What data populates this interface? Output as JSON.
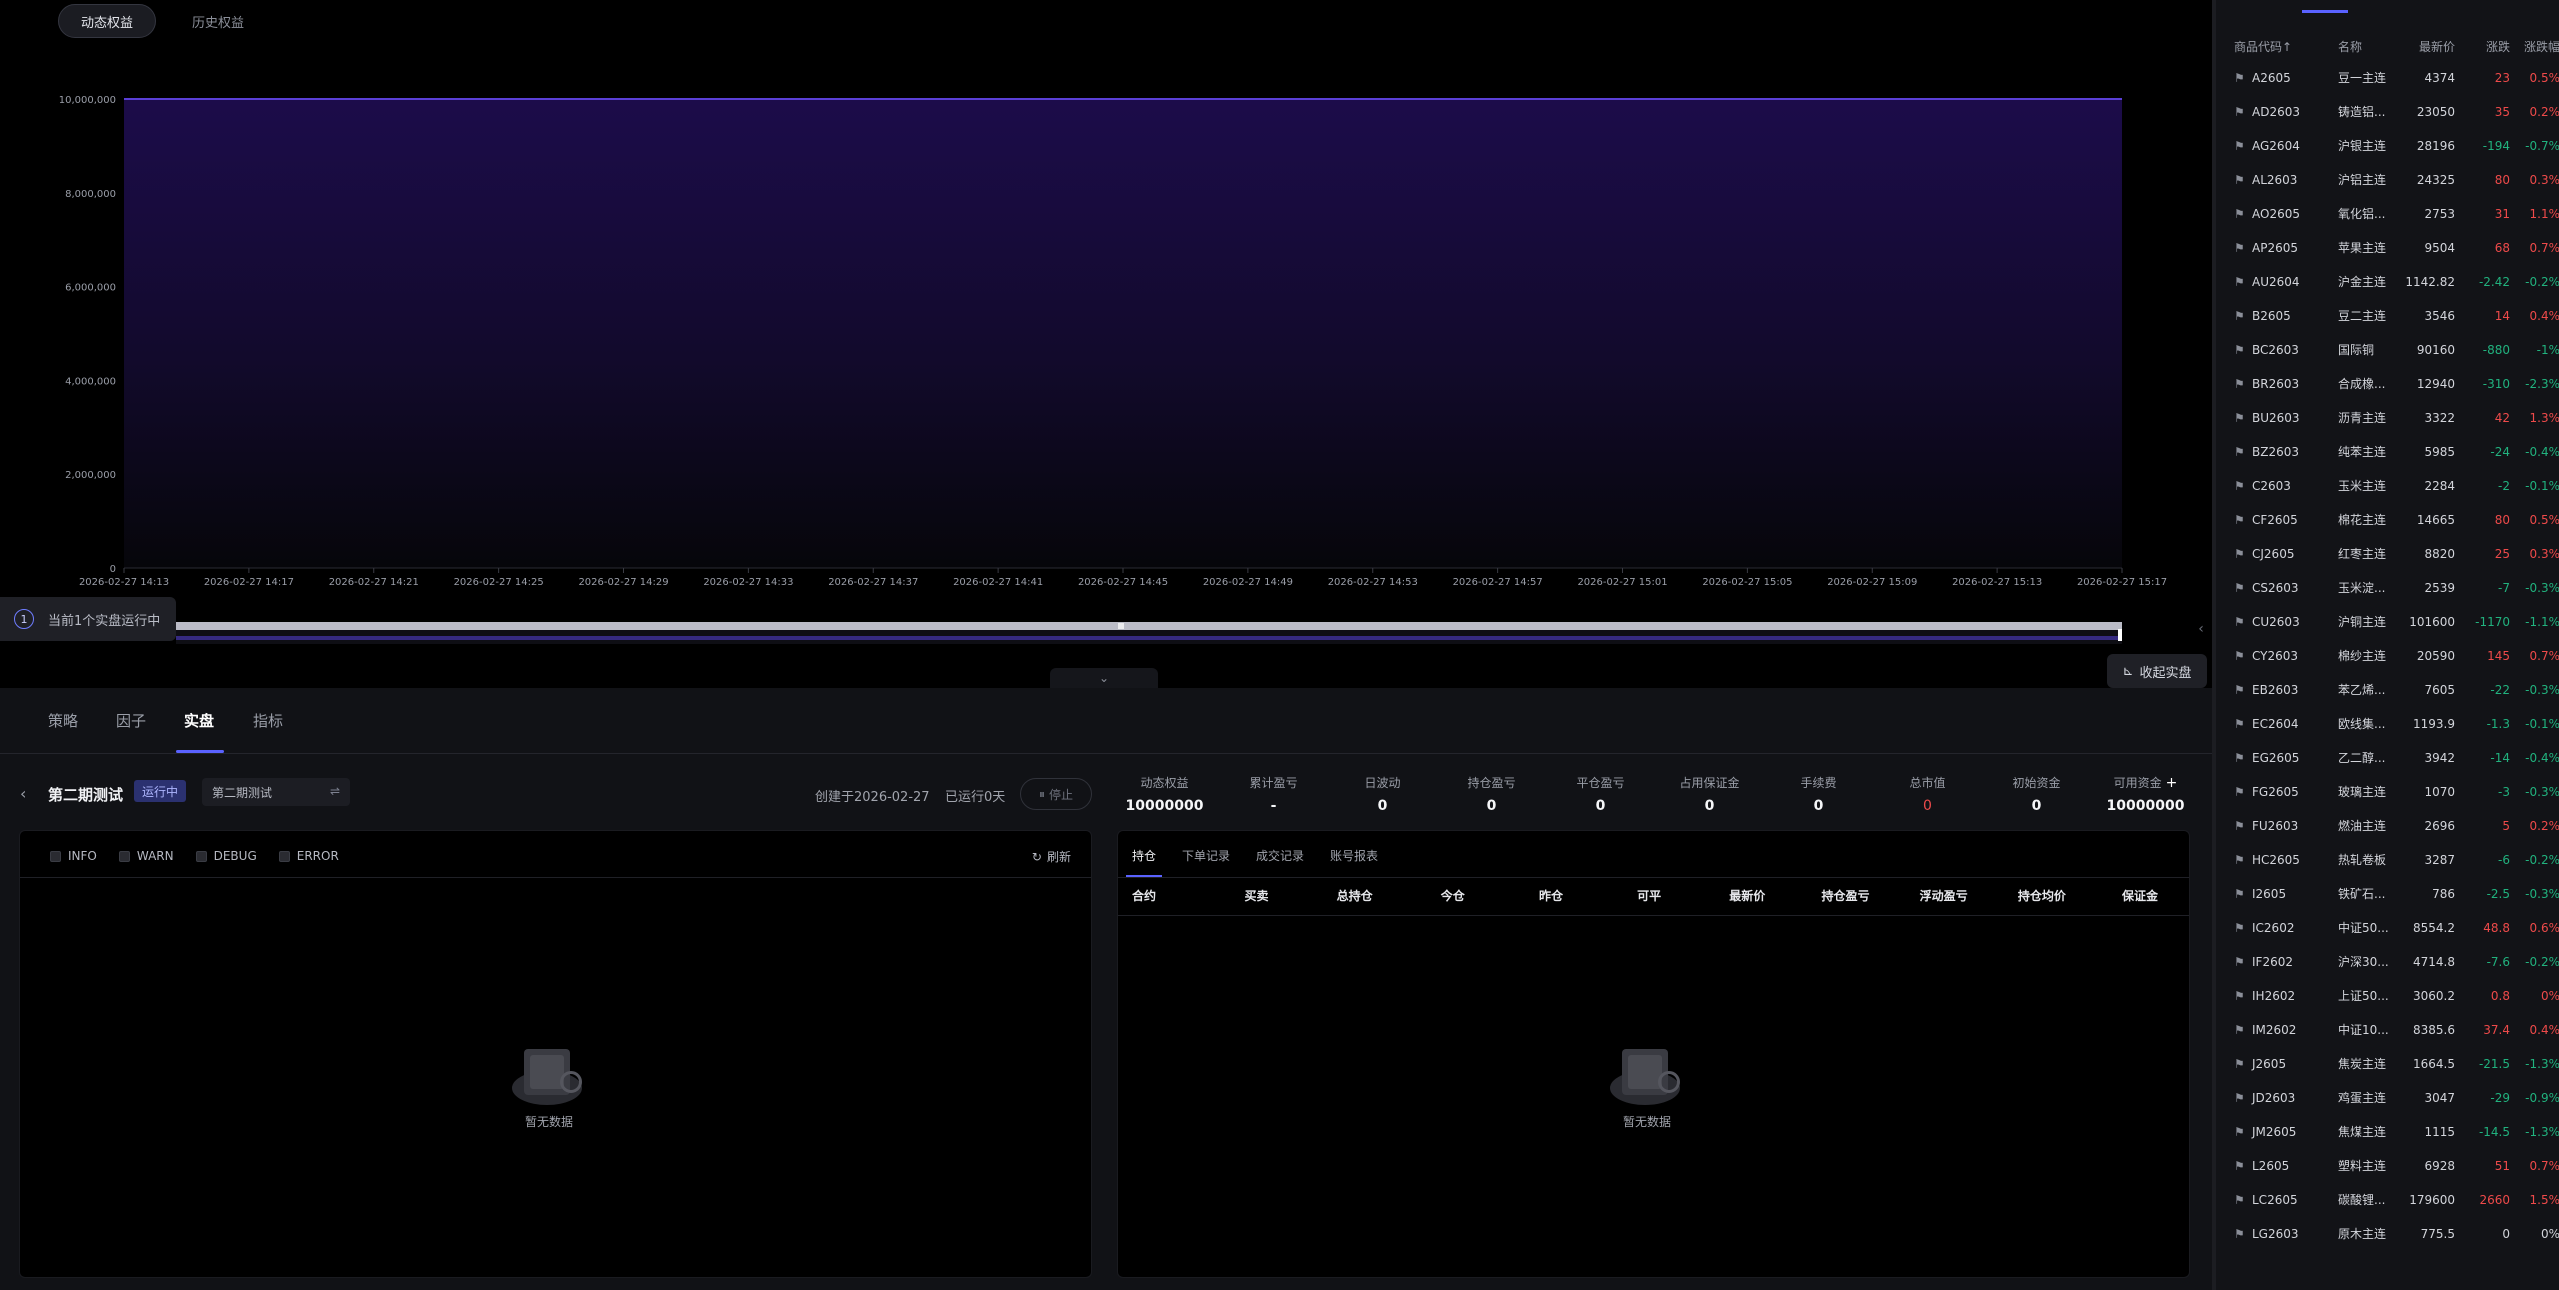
{
  "top_tabs": [
    "动态权益",
    "历史权益"
  ],
  "running_badge": {
    "count": "1",
    "label": "当前1个实盘运行中"
  },
  "collapse_live_label": "收起实盘",
  "chart_data": {
    "type": "area",
    "x": [
      "2026-02-27 14:13",
      "2026-02-27 14:17",
      "2026-02-27 14:21",
      "2026-02-27 14:25",
      "2026-02-27 14:29",
      "2026-02-27 14:33",
      "2026-02-27 14:37",
      "2026-02-27 14:41",
      "2026-02-27 14:45",
      "2026-02-27 14:49",
      "2026-02-27 14:53",
      "2026-02-27 14:57",
      "2026-02-27 15:01",
      "2026-02-27 15:05",
      "2026-02-27 15:09",
      "2026-02-27 15:13",
      "2026-02-27 15:17"
    ],
    "series": [
      {
        "values": [
          10000000,
          10000000,
          10000000,
          10000000,
          10000000,
          10000000,
          10000000,
          10000000,
          10000000,
          10000000,
          10000000,
          10000000,
          10000000,
          10000000,
          10000000,
          10000000,
          10000000
        ]
      }
    ],
    "y_ticks": [
      "0",
      "2,000,000",
      "4,000,000",
      "6,000,000",
      "8,000,000",
      "10,000,000"
    ],
    "ylim": [
      0,
      10000000
    ],
    "grid": true,
    "line_color": "#5a3fd6"
  },
  "bottom_tabs": [
    "策略",
    "因子",
    "实盘",
    "指标"
  ],
  "strategy": {
    "name": "第二期测试",
    "status": "运行中",
    "select_value": "第二期测试",
    "created": "创建于2026-02-27",
    "running": "已运行0天",
    "stop_label": "停止"
  },
  "metrics": [
    {
      "label": "动态权益",
      "value": "10000000"
    },
    {
      "label": "累计盈亏",
      "value": "-"
    },
    {
      "label": "日波动",
      "value": "0"
    },
    {
      "label": "持仓盈亏",
      "value": "0"
    },
    {
      "label": "平仓盈亏",
      "value": "0"
    },
    {
      "label": "占用保证金",
      "value": "0"
    },
    {
      "label": "手续费",
      "value": "0"
    },
    {
      "label": "总市值",
      "value": "0"
    },
    {
      "label": "初始资金",
      "value": "0"
    },
    {
      "label": "可用资金",
      "value": "10000000"
    }
  ],
  "log": {
    "filters": [
      "INFO",
      "WARN",
      "DEBUG",
      "ERROR"
    ],
    "refresh_label": "刷新"
  },
  "empty_text": "暂无数据",
  "positions": {
    "tabs": [
      "持仓",
      "下单记录",
      "成交记录",
      "账号报表"
    ],
    "columns": [
      "合约",
      "买卖",
      "总持仓",
      "今仓",
      "昨仓",
      "可平",
      "最新价",
      "持仓盈亏",
      "浮动盈亏",
      "持仓均价",
      "保证金"
    ]
  },
  "market": {
    "headers": [
      "商品代码↑",
      "名称",
      "最新价",
      "涨跌",
      "涨跌幅"
    ],
    "colors": {
      "up": "#ee4a4a",
      "down": "#21b27e"
    },
    "rows": [
      {
        "code": "A2605",
        "name": "豆一主连",
        "price": "4374",
        "chg": "23",
        "pct": "0.5%",
        "dir": "up"
      },
      {
        "code": "AD2603",
        "name": "铸造铝...",
        "price": "23050",
        "chg": "35",
        "pct": "0.2%",
        "dir": "up"
      },
      {
        "code": "AG2604",
        "name": "沪银主连",
        "price": "28196",
        "chg": "-194",
        "pct": "-0.7%",
        "dir": "down"
      },
      {
        "code": "AL2603",
        "name": "沪铝主连",
        "price": "24325",
        "chg": "80",
        "pct": "0.3%",
        "dir": "up"
      },
      {
        "code": "AO2605",
        "name": "氧化铝...",
        "price": "2753",
        "chg": "31",
        "pct": "1.1%",
        "dir": "up"
      },
      {
        "code": "AP2605",
        "name": "苹果主连",
        "price": "9504",
        "chg": "68",
        "pct": "0.7%",
        "dir": "up"
      },
      {
        "code": "AU2604",
        "name": "沪金主连",
        "price": "1142.82",
        "chg": "-2.42",
        "pct": "-0.2%",
        "dir": "down"
      },
      {
        "code": "B2605",
        "name": "豆二主连",
        "price": "3546",
        "chg": "14",
        "pct": "0.4%",
        "dir": "up"
      },
      {
        "code": "BC2603",
        "name": "国际铜",
        "price": "90160",
        "chg": "-880",
        "pct": "-1%",
        "dir": "down"
      },
      {
        "code": "BR2603",
        "name": "合成橡...",
        "price": "12940",
        "chg": "-310",
        "pct": "-2.3%",
        "dir": "down"
      },
      {
        "code": "BU2603",
        "name": "沥青主连",
        "price": "3322",
        "chg": "42",
        "pct": "1.3%",
        "dir": "up"
      },
      {
        "code": "BZ2603",
        "name": "纯苯主连",
        "price": "5985",
        "chg": "-24",
        "pct": "-0.4%",
        "dir": "down"
      },
      {
        "code": "C2603",
        "name": "玉米主连",
        "price": "2284",
        "chg": "-2",
        "pct": "-0.1%",
        "dir": "down"
      },
      {
        "code": "CF2605",
        "name": "棉花主连",
        "price": "14665",
        "chg": "80",
        "pct": "0.5%",
        "dir": "up"
      },
      {
        "code": "CJ2605",
        "name": "红枣主连",
        "price": "8820",
        "chg": "25",
        "pct": "0.3%",
        "dir": "up"
      },
      {
        "code": "CS2603",
        "name": "玉米淀...",
        "price": "2539",
        "chg": "-7",
        "pct": "-0.3%",
        "dir": "down"
      },
      {
        "code": "CU2603",
        "name": "沪铜主连",
        "price": "101600",
        "chg": "-1170",
        "pct": "-1.1%",
        "dir": "down"
      },
      {
        "code": "CY2603",
        "name": "棉纱主连",
        "price": "20590",
        "chg": "145",
        "pct": "0.7%",
        "dir": "up"
      },
      {
        "code": "EB2603",
        "name": "苯乙烯...",
        "price": "7605",
        "chg": "-22",
        "pct": "-0.3%",
        "dir": "down"
      },
      {
        "code": "EC2604",
        "name": "欧线集...",
        "price": "1193.9",
        "chg": "-1.3",
        "pct": "-0.1%",
        "dir": "down"
      },
      {
        "code": "EG2605",
        "name": "乙二醇...",
        "price": "3942",
        "chg": "-14",
        "pct": "-0.4%",
        "dir": "down"
      },
      {
        "code": "FG2605",
        "name": "玻璃主连",
        "price": "1070",
        "chg": "-3",
        "pct": "-0.3%",
        "dir": "down"
      },
      {
        "code": "FU2603",
        "name": "燃油主连",
        "price": "2696",
        "chg": "5",
        "pct": "0.2%",
        "dir": "up"
      },
      {
        "code": "HC2605",
        "name": "热轧卷板",
        "price": "3287",
        "chg": "-6",
        "pct": "-0.2%",
        "dir": "down"
      },
      {
        "code": "I2605",
        "name": "铁矿石...",
        "price": "786",
        "chg": "-2.5",
        "pct": "-0.3%",
        "dir": "down"
      },
      {
        "code": "IC2602",
        "name": "中证50...",
        "price": "8554.2",
        "chg": "48.8",
        "pct": "0.6%",
        "dir": "up"
      },
      {
        "code": "IF2602",
        "name": "沪深30...",
        "price": "4714.8",
        "chg": "-7.6",
        "pct": "-0.2%",
        "dir": "down"
      },
      {
        "code": "IH2602",
        "name": "上证50...",
        "price": "3060.2",
        "chg": "0.8",
        "pct": "0%",
        "dir": "up"
      },
      {
        "code": "IM2602",
        "name": "中证10...",
        "price": "8385.6",
        "chg": "37.4",
        "pct": "0.4%",
        "dir": "up"
      },
      {
        "code": "J2605",
        "name": "焦炭主连",
        "price": "1664.5",
        "chg": "-21.5",
        "pct": "-1.3%",
        "dir": "down"
      },
      {
        "code": "JD2603",
        "name": "鸡蛋主连",
        "price": "3047",
        "chg": "-29",
        "pct": "-0.9%",
        "dir": "down"
      },
      {
        "code": "JM2605",
        "name": "焦煤主连",
        "price": "1115",
        "chg": "-14.5",
        "pct": "-1.3%",
        "dir": "down"
      },
      {
        "code": "L2605",
        "name": "塑料主连",
        "price": "6928",
        "chg": "51",
        "pct": "0.7%",
        "dir": "up"
      },
      {
        "code": "LC2605",
        "name": "碳酸锂...",
        "price": "179600",
        "chg": "2660",
        "pct": "1.5%",
        "dir": "up"
      },
      {
        "code": "LG2603",
        "name": "原木主连",
        "price": "775.5",
        "chg": "0",
        "pct": "0%",
        "dir": "flat"
      }
    ]
  }
}
